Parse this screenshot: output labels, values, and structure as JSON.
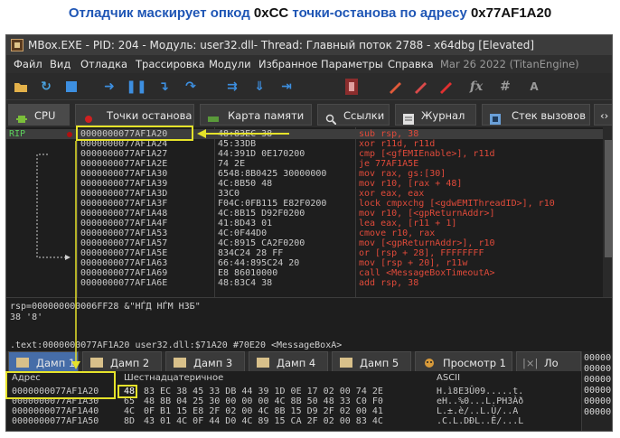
{
  "caption": {
    "part1": "Отладчик маскирует опкод ",
    "part2": "0xCC",
    "part3": " точки-останова по адресу ",
    "part4": "0x77AF1A20"
  },
  "window": {
    "title": "MBox.EXE - PID: 204 - Модуль: user32.dll- Thread: Главный поток 2788 - x64dbg [Elevated]"
  },
  "menu": {
    "items": [
      "Файл",
      "Вид",
      "Отладка",
      "Трассировка",
      "Модули",
      "Избранное",
      "Параметры",
      "Справка"
    ],
    "date": "Mar 26 2022 (TitanEngine)"
  },
  "toolbar": {
    "icons": [
      "open-icon",
      "restart-icon",
      "stop-icon",
      "run-icon",
      "pause-icon",
      "step-into-icon",
      "step-over-icon",
      "trace-into-icon",
      "trace-over-icon",
      "execute-till-return-icon",
      "scylla-icon",
      "patch-icon",
      "comment-icon",
      "label-icon",
      "fx-icon",
      "hash-icon",
      "font-icon"
    ],
    "fx_label": "fx",
    "hash_label": "#",
    "font_label": "A"
  },
  "tabs": [
    {
      "label": "CPU",
      "icon": "cpu-icon"
    },
    {
      "label": "Точки останова",
      "icon": "breakpoint-icon"
    },
    {
      "label": "Карта памяти",
      "icon": "memory-map-icon"
    },
    {
      "label": "Ссылки",
      "icon": "references-icon"
    },
    {
      "label": "Журнал",
      "icon": "log-icon"
    },
    {
      "label": "Стек вызовов",
      "icon": "callstack-icon"
    }
  ],
  "disasm": {
    "rip_label": "RIP",
    "rows": [
      {
        "addr": "0000000077AF1A20",
        "bytes": "48:83EC 38",
        "instr": "sub      rsp, 38"
      },
      {
        "addr": "0000000077AF1A24",
        "bytes": "45:33DB",
        "instr": "xor      r11d, r11d"
      },
      {
        "addr": "0000000077AF1A27",
        "bytes": "44:391D 0E170200",
        "instr": "cmp      [<gfEMIEnable>], r11d"
      },
      {
        "addr": "0000000077AF1A2E",
        "bytes": "74 2E",
        "instr": "je       77AF1A5E"
      },
      {
        "addr": "0000000077AF1A30",
        "bytes": "6548:8B0425 30000000",
        "instr": "mov      rax, gs:[30]"
      },
      {
        "addr": "0000000077AF1A39",
        "bytes": "4C:8B50 48",
        "instr": "mov      r10, [rax + 48]"
      },
      {
        "addr": "0000000077AF1A3D",
        "bytes": "33C0",
        "instr": "xor      eax, eax"
      },
      {
        "addr": "0000000077AF1A3F",
        "bytes": "F04C:0FB115 E82F0200",
        "instr": "lock cmpxchg [<gdwEMIThreadID>], r10"
      },
      {
        "addr": "0000000077AF1A48",
        "bytes": "4C:8B15 D92F0200",
        "instr": "mov      r10, [<gpReturnAddr>]"
      },
      {
        "addr": "0000000077AF1A4F",
        "bytes": "41:8D43 01",
        "instr": "lea      eax, [r11 + 1]"
      },
      {
        "addr": "0000000077AF1A53",
        "bytes": "4C:0F44D0",
        "instr": "cmove    r10, rax"
      },
      {
        "addr": "0000000077AF1A57",
        "bytes": "4C:8915 CA2F0200",
        "instr": "mov      [<gpReturnAddr>], r10"
      },
      {
        "addr": "0000000077AF1A5E",
        "bytes": "834C24 28 FF",
        "instr": "or       [rsp + 28], FFFFFFFF"
      },
      {
        "addr": "0000000077AF1A63",
        "bytes": "66:44:895C24 20",
        "instr": "mov      [rsp + 20], r11w"
      },
      {
        "addr": "0000000077AF1A69",
        "bytes": "E8 86010000",
        "instr": "call     <MessageBoxTimeoutA>"
      },
      {
        "addr": "0000000077AF1A6E",
        "bytes": "48:83C4 38",
        "instr": "add      rsp, 38"
      }
    ]
  },
  "info": {
    "line1": "rsp=000000000006FF28 &\"НЃД НЃМ НЗБ\"",
    "line2": "38 '8'"
  },
  "status": ".text:0000000077AF1A20 user32.dll:$71A20 #70E20 <MessageBoxA>",
  "dump_tabs": [
    {
      "label": "Дамп 1"
    },
    {
      "label": "Дамп 2"
    },
    {
      "label": "Дамп 3"
    },
    {
      "label": "Дамп 4"
    },
    {
      "label": "Дамп 5"
    },
    {
      "label": "Просмотр 1"
    },
    {
      "label": "Ло"
    }
  ],
  "dump": {
    "hdr_addr": "Адрес",
    "hdr_hex": "Шестнадцатеричное",
    "hdr_ascii": "ASCII",
    "rows": [
      {
        "addr": "0000000077AF1A20",
        "first": "48",
        "hex": "83 EC 38 45 33 DB 44 39 1D 0E 17 02 00 74 2E",
        "ascii": "H.ì8E3Û09.....t."
      },
      {
        "addr": "0000000077AF1A30",
        "first": "65",
        "hex": "48 8B 04 25 30 00 00 00 4C 8B 50 48 33 C0 F0",
        "ascii": "eH..%0...L.PH3Àð"
      },
      {
        "addr": "0000000077AF1A40",
        "first": "4C",
        "hex": "0F B1 15 E8 2F 02 00 4C 8B 15 D9 2F 02 00 41",
        "ascii": "L.±.è/..L.Ù/..A"
      },
      {
        "addr": "0000000077AF1A50",
        "first": "8D",
        "hex": "43 01 4C 0F 44 D0 4C 89 15 CA 2F 02 00 83 4C",
        "ascii": ".C.L.DÐL..Ê/...L"
      }
    ]
  },
  "right_panel": {
    "rows": [
      "00000",
      "00000",
      "00000",
      "00000",
      "00000",
      "00000"
    ]
  },
  "colors": {
    "caption_blue": "#1f56b5",
    "highlight_yellow": "#e5e22a",
    "instr_red": "#e04a3a",
    "rip_green": "#5cd05c"
  }
}
